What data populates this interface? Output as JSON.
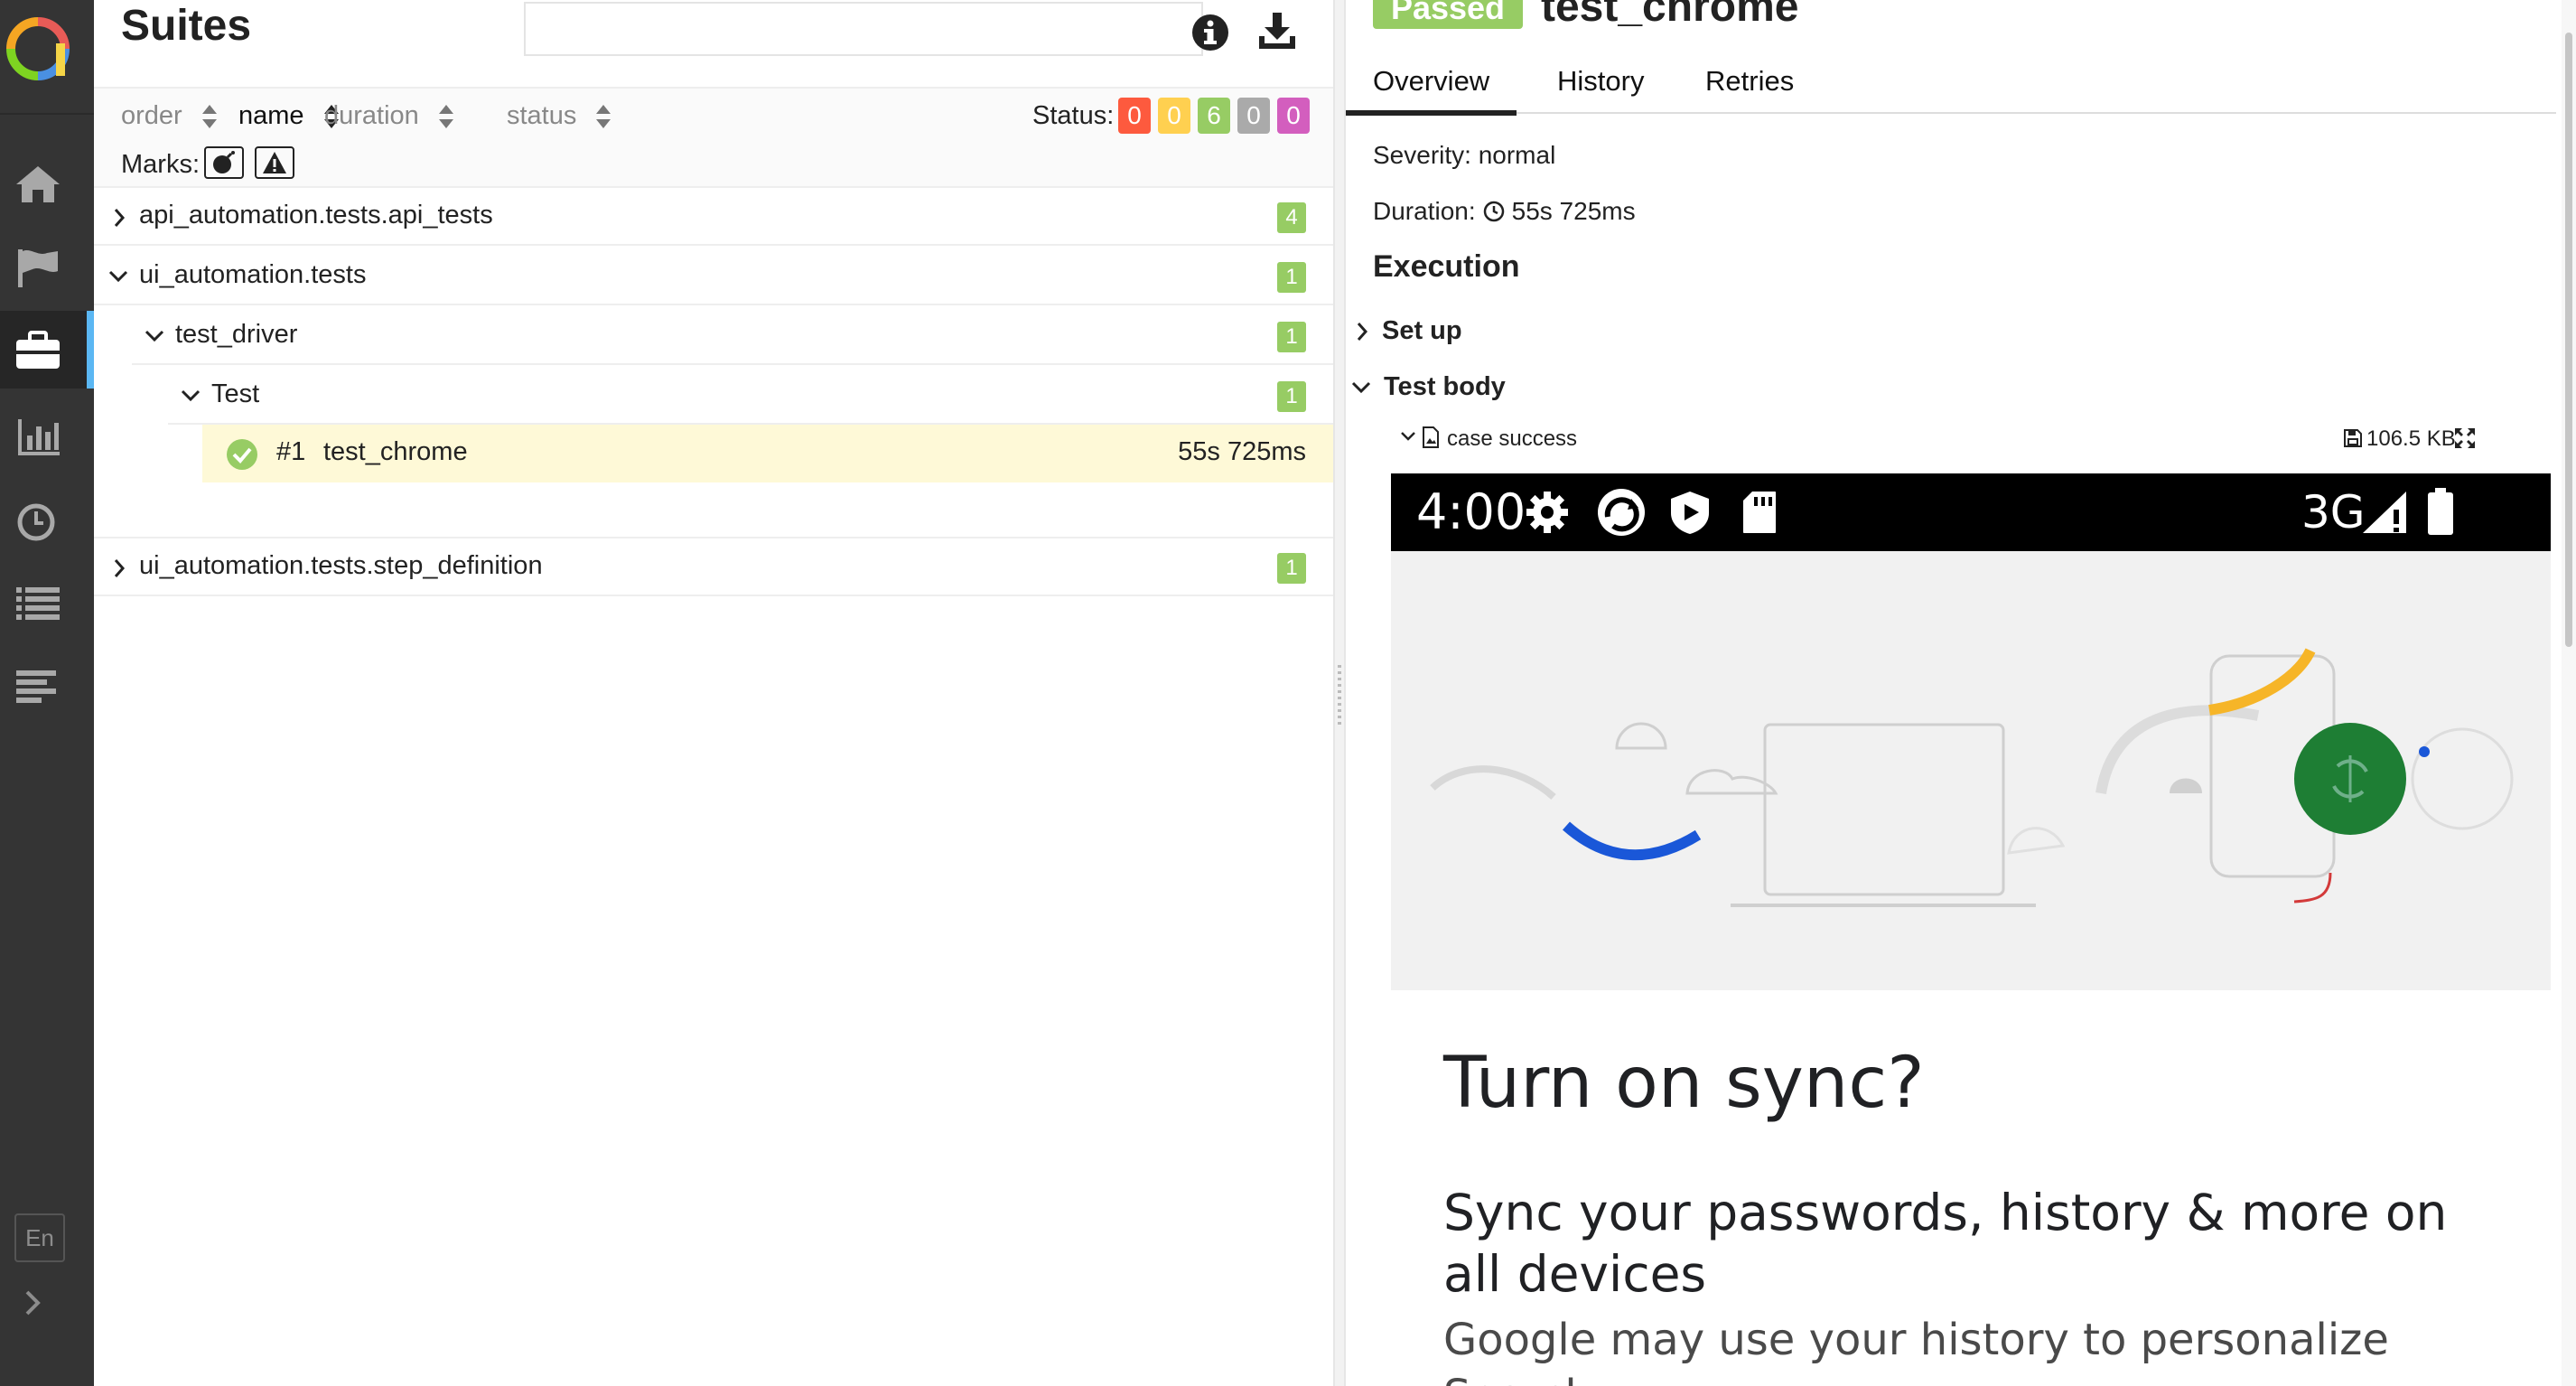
{
  "nav": {
    "items": [
      {
        "name": "overview",
        "icon": "home-icon"
      },
      {
        "name": "categories",
        "icon": "flag-icon"
      },
      {
        "name": "suites",
        "icon": "briefcase-icon",
        "active": true
      },
      {
        "name": "graphs",
        "icon": "bar-chart-icon"
      },
      {
        "name": "timeline",
        "icon": "clock-icon"
      },
      {
        "name": "behaviors",
        "icon": "list-icon"
      },
      {
        "name": "packages",
        "icon": "align-left-icon"
      }
    ],
    "language": "En",
    "active_color": "#5bb7f3"
  },
  "suites": {
    "title": "Suites",
    "search": {
      "value": "",
      "placeholder": ""
    },
    "sort": {
      "order": "order",
      "name": "name",
      "duration": "duration",
      "status": "status"
    },
    "status_label": "Status:",
    "counts": [
      {
        "label": "failed",
        "value": "0",
        "color": "#fd5a3e"
      },
      {
        "label": "broken",
        "value": "0",
        "color": "#ffd050"
      },
      {
        "label": "passed",
        "value": "6",
        "color": "#97cc64"
      },
      {
        "label": "skipped",
        "value": "0",
        "color": "#aaaaaa"
      },
      {
        "label": "unknown",
        "value": "0",
        "color": "#d35ebe"
      }
    ],
    "marks_label": "Marks:",
    "tree": {
      "api": {
        "name": "api_automation.tests.api_tests",
        "count": "4"
      },
      "ui": {
        "name": "ui_automation.tests",
        "count": "1"
      },
      "driver": {
        "name": "test_driver",
        "count": "1"
      },
      "test": {
        "name": "Test",
        "count": "1"
      },
      "leaf": {
        "order": "#1",
        "name": "test_chrome",
        "duration": "55s 725ms"
      },
      "step_def": {
        "name": "ui_automation.tests.step_definition",
        "count": "1"
      }
    }
  },
  "details": {
    "status": "Passed",
    "status_color": "#97cc64",
    "title": "test_chrome",
    "tabs": [
      "Overview",
      "History",
      "Retries"
    ],
    "severity": "Severity: normal",
    "duration_label": "Duration:",
    "duration_value": "55s 725ms",
    "execution": "Execution",
    "setup": "Set up",
    "test_body": "Test body",
    "attachment": {
      "name": "case success",
      "size": "106.5 KB"
    },
    "phone": {
      "time": "4:00",
      "network": "3G",
      "heading": "Turn on sync?",
      "subheading": "Sync your passwords, history & more on all devices",
      "body": "Google may use your history to personalize Search",
      "sync_color": "#1e7e34"
    }
  }
}
